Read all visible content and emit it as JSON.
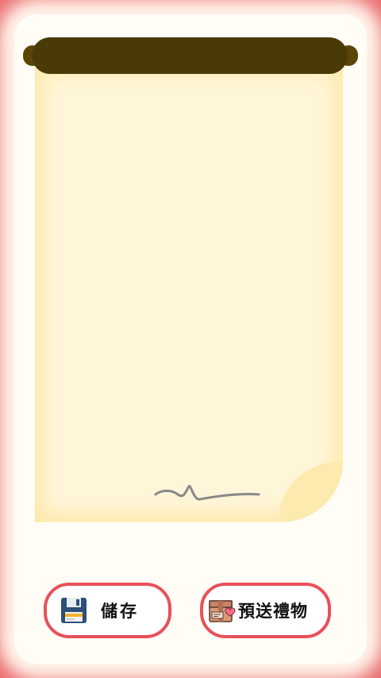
{
  "colors": {
    "frame": "#e85a5e",
    "paper": "#fff5d8",
    "paper_edge": "#fdeaae",
    "rod": "#4a3a08",
    "button_border": "#e8515a"
  },
  "actions": {
    "save": {
      "label": "儲存",
      "icon": "floppy-disk-icon"
    },
    "gift": {
      "label": "預送禮物",
      "icon": "gift-box-icon"
    }
  }
}
